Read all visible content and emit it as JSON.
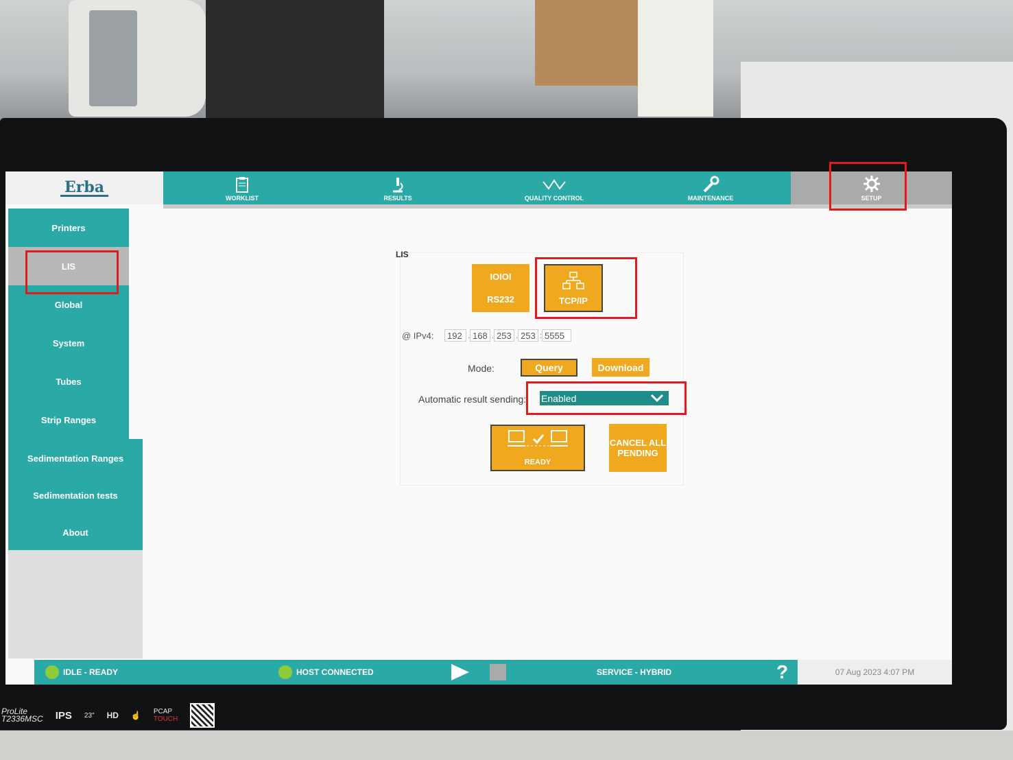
{
  "header": {
    "logo": "Erba",
    "nav": [
      {
        "label": "WORKLIST",
        "icon": "clipboard-icon"
      },
      {
        "label": "RESULTS",
        "icon": "microscope-icon"
      },
      {
        "label": "QUALITY CONTROL",
        "icon": "qc-graph-icon"
      },
      {
        "label": "MAINTENANCE",
        "icon": "wrench-icon"
      },
      {
        "label": "SETUP",
        "icon": "gear-icon"
      }
    ]
  },
  "sidebar": {
    "items": [
      "Printers",
      "LIS",
      "Global",
      "System",
      "Tubes",
      "Strip Ranges",
      "Sedimentation Ranges",
      "Sedimentation tests",
      "About"
    ],
    "active": "LIS"
  },
  "lis": {
    "title": "LIS",
    "connection_options": [
      {
        "icon_text": "IOIOI",
        "label": "RS232",
        "selected": false
      },
      {
        "icon_text": "",
        "label": "TCP/IP",
        "selected": true
      }
    ],
    "ipv4_label": "@ IPv4:",
    "ipv4": [
      "192",
      "168",
      "253",
      "253"
    ],
    "port": "5555",
    "mode_label": "Mode:",
    "mode_options": [
      "Query",
      "Download"
    ],
    "mode_selected": "Query",
    "auto_send_label": "Automatic result sending:",
    "auto_send_value": "Enabled",
    "ready_label": "READY",
    "cancel_label_1": "CANCEL ALL",
    "cancel_label_2": "PENDING"
  },
  "status_bar": {
    "state": "IDLE - READY",
    "host": "HOST CONNECTED",
    "service": "SERVICE - HYBRID",
    "help": "?",
    "datetime": "07 Aug 2023   4:07 PM"
  },
  "monitor": {
    "brand": "ProLite",
    "model": "T2336MSC",
    "panel": "IPS",
    "size": "23\"",
    "hd": "HD",
    "touch_1": "PCAP",
    "touch_2": "TOUCH"
  },
  "colors": {
    "teal": "#2aa9a6",
    "orange": "#f0a81e",
    "highlight": "#e01b1b"
  }
}
